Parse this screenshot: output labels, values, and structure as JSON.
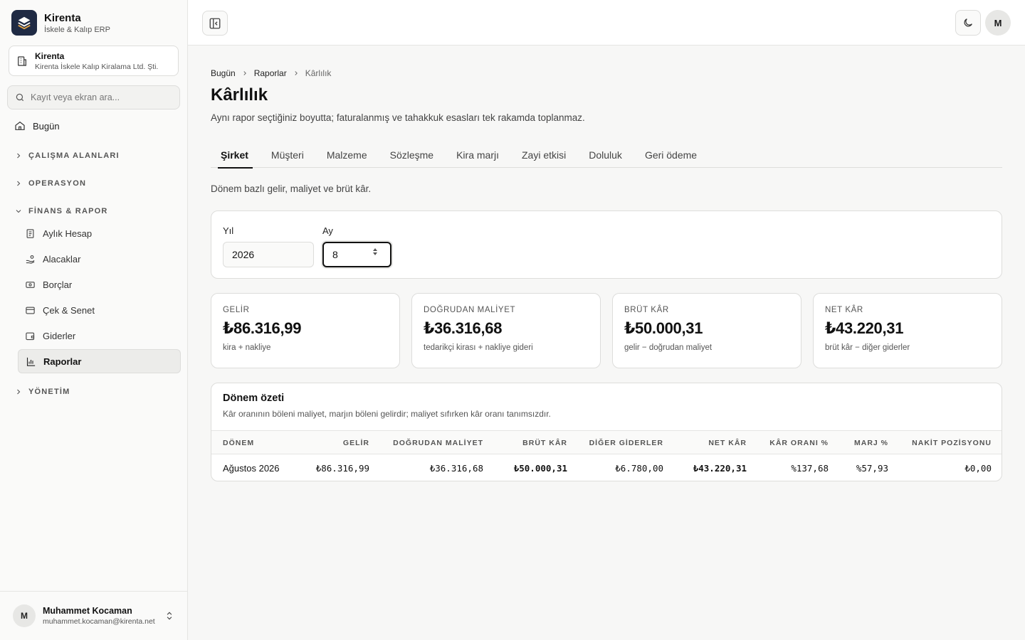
{
  "app": {
    "name": "Kirenta",
    "subtitle": "İskele & Kalıp ERP"
  },
  "org": {
    "name": "Kirenta",
    "legal_name": "Kirenta İskele Kalıp Kiralama Ltd. Şti."
  },
  "search": {
    "placeholder": "Kayıt veya ekran ara..."
  },
  "sidebar": {
    "home": "Bugün",
    "groups": {
      "workspaces": "ÇALIŞMA ALANLARI",
      "operations": "OPERASYON",
      "finance": "FİNANS & RAPOR",
      "admin": "YÖNETİM"
    },
    "finance_items": [
      "Aylık Hesap",
      "Alacaklar",
      "Borçlar",
      "Çek & Senet",
      "Giderler",
      "Raporlar"
    ]
  },
  "user": {
    "initial": "M",
    "name": "Muhammet Kocaman",
    "email": "muhammet.kocaman@kirenta.net"
  },
  "header": {
    "avatar_initial": "M"
  },
  "breadcrumb": [
    "Bugün",
    "Raporlar",
    "Kârlılık"
  ],
  "page": {
    "title": "Kârlılık",
    "description": "Aynı rapor seçtiğiniz boyutta; faturalanmış ve tahakkuk esasları tek rakamda toplanmaz."
  },
  "tabs": [
    "Şirket",
    "Müşteri",
    "Malzeme",
    "Sözleşme",
    "Kira marjı",
    "Zayi etkisi",
    "Doluluk",
    "Geri ödeme"
  ],
  "section": {
    "description": "Dönem bazlı gelir, maliyet ve brüt kâr."
  },
  "filters": {
    "year_label": "Yıl",
    "year_value": "2026",
    "month_label": "Ay",
    "month_value": "8"
  },
  "kpis": [
    {
      "label": "GELİR",
      "value": "₺86.316,99",
      "note": "kira + nakliye"
    },
    {
      "label": "DOĞRUDAN MALİYET",
      "value": "₺36.316,68",
      "note": "tedarikçi kirası + nakliye gideri"
    },
    {
      "label": "BRÜT KÂR",
      "value": "₺50.000,31",
      "note": "gelir − doğrudan maliyet"
    },
    {
      "label": "NET KÂR",
      "value": "₺43.220,31",
      "note": "brüt kâr − diğer giderler"
    }
  ],
  "summary": {
    "title": "Dönem özeti",
    "description": "Kâr oranının böleni maliyet, marjın böleni gelirdir; maliyet sıfırken kâr oranı tanımsızdır.",
    "columns": [
      "DÖNEM",
      "GELİR",
      "DOĞRUDAN MALİYET",
      "BRÜT KÂR",
      "DİĞER GİDERLER",
      "NET KÂR",
      "KÂR ORANI %",
      "MARJ %",
      "NAKİT POZİSYONU"
    ],
    "rows": [
      [
        "Ağustos 2026",
        "₺86.316,99",
        "₺36.316,68",
        "₺50.000,31",
        "₺6.780,00",
        "₺43.220,31",
        "%137,68",
        "%57,93",
        "₺0,00"
      ]
    ]
  }
}
